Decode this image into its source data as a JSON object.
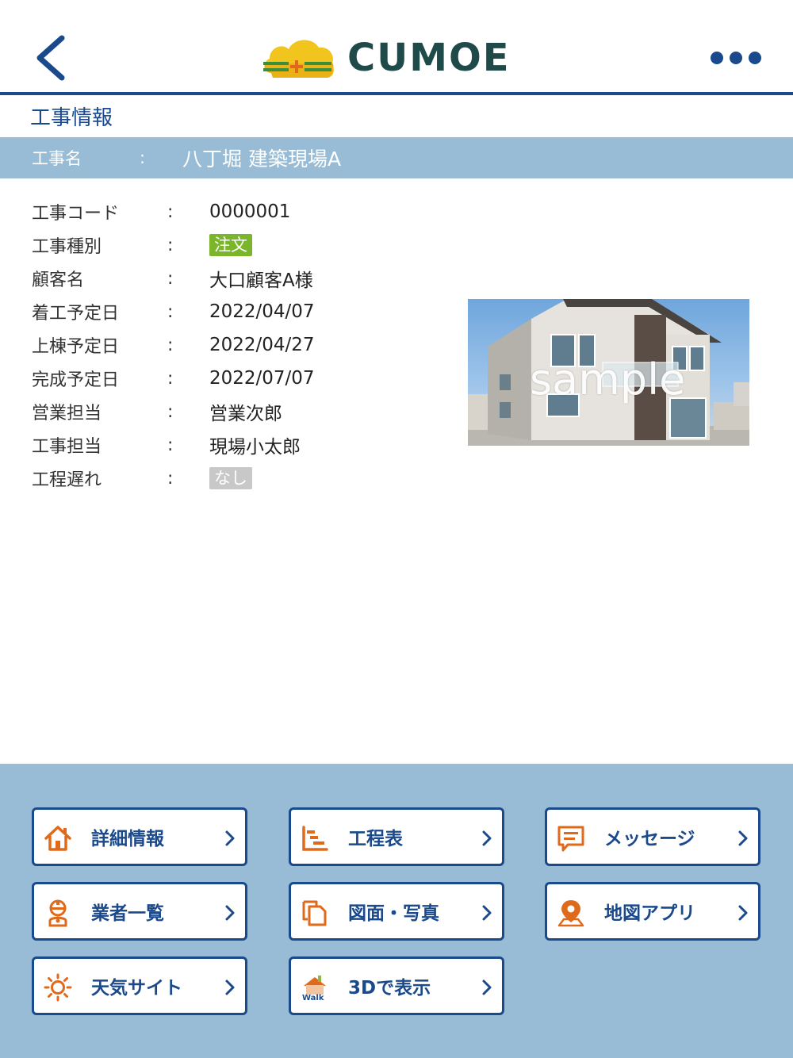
{
  "header": {
    "logo_text": "CUMOE"
  },
  "section_title": "工事情報",
  "project_name": {
    "label": "工事名",
    "colon": ":",
    "value": "八丁堀 建築現場A"
  },
  "details": [
    {
      "label": "工事コード",
      "colon": ":",
      "value": "0000001",
      "type": "text"
    },
    {
      "label": "工事種別",
      "colon": ":",
      "value": "注文",
      "type": "badge-green"
    },
    {
      "label": "顧客名",
      "colon": ":",
      "value": "大口顧客A様",
      "type": "text"
    },
    {
      "label": "着工予定日",
      "colon": ":",
      "value": "2022/04/07",
      "type": "text"
    },
    {
      "label": "上棟予定日",
      "colon": ":",
      "value": "2022/04/27",
      "type": "text"
    },
    {
      "label": "完成予定日",
      "colon": ":",
      "value": "2022/07/07",
      "type": "text"
    },
    {
      "label": "営業担当",
      "colon": ":",
      "value": "営業次郎",
      "type": "text"
    },
    {
      "label": "工事担当",
      "colon": ":",
      "value": "現場小太郎",
      "type": "text"
    },
    {
      "label": "工程遅れ",
      "colon": ":",
      "value": "なし",
      "type": "badge-gray"
    }
  ],
  "photo": {
    "watermark": "sample"
  },
  "menu": [
    {
      "label": "詳細情報",
      "icon": "house-icon"
    },
    {
      "label": "工程表",
      "icon": "gantt-chart-icon"
    },
    {
      "label": "メッセージ",
      "icon": "message-icon"
    },
    {
      "label": "業者一覧",
      "icon": "worker-icon"
    },
    {
      "label": "図面・写真",
      "icon": "document-copy-icon"
    },
    {
      "label": "地図アプリ",
      "icon": "map-pin-icon"
    },
    {
      "label": "天気サイト",
      "icon": "sun-icon"
    },
    {
      "label": "3Dで表示",
      "icon": "walk-in-3d-icon"
    }
  ],
  "colors": {
    "primary": "#1b4a8c",
    "bar": "#98bcd5",
    "accent": "#e06a1b",
    "badge_green": "#7bb52b",
    "badge_gray": "#c8c8c8"
  }
}
